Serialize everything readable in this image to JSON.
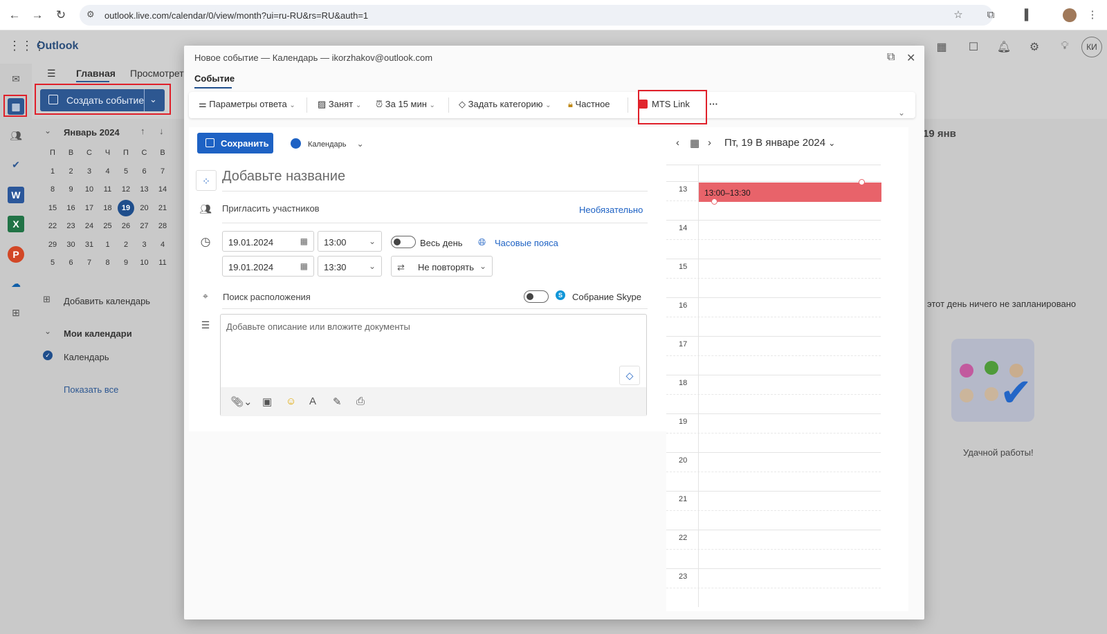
{
  "browser": {
    "url": "outlook.live.com/calendar/0/view/month?ui=ru-RU&rs=RU&auth=1"
  },
  "outlook": {
    "brand": "Outlook",
    "ribbon_tabs": [
      "Главная",
      "Просмотреть"
    ],
    "create_event_label": "Создать событие",
    "user_initials": "КИ",
    "mini_calendar": {
      "title": "Январь 2024",
      "weekdays": [
        "П",
        "В",
        "С",
        "Ч",
        "П",
        "С",
        "В"
      ],
      "weeks": [
        [
          "1",
          "2",
          "3",
          "4",
          "5",
          "6",
          "7"
        ],
        [
          "8",
          "9",
          "10",
          "11",
          "12",
          "13",
          "14"
        ],
        [
          "15",
          "16",
          "17",
          "18",
          "19",
          "20",
          "21"
        ],
        [
          "22",
          "23",
          "24",
          "25",
          "26",
          "27",
          "28"
        ],
        [
          "29",
          "30",
          "31",
          "1",
          "2",
          "3",
          "4"
        ],
        [
          "5",
          "6",
          "7",
          "8",
          "9",
          "10",
          "11"
        ]
      ],
      "today": "19"
    },
    "add_calendar": "Добавить календарь",
    "my_calendars": "Мои календари",
    "calendar_name": "Календарь",
    "show_all": "Показать все",
    "right_panel": {
      "title": "19 янв",
      "empty_text": "этот день ничего не запланировано",
      "good_work": "Удачной работы!"
    }
  },
  "modal": {
    "title": "Новое событие — Календарь — ikorzhakov@outlook.com",
    "tab": "Событие",
    "toolbar": {
      "response_options": "Параметры ответа",
      "busy": "Занят",
      "reminder": "За 15 мин",
      "category": "Задать категорию",
      "private": "Частное",
      "mts_link": "MTS Link",
      "more": "···"
    },
    "save": "Сохранить",
    "calendar_select": "Календарь",
    "title_placeholder": "Добавьте название",
    "invite_placeholder": "Пригласить участников",
    "optional": "Необязательно",
    "start_date": "19.01.2024",
    "start_time": "13:00",
    "end_date": "19.01.2024",
    "end_time": "13:30",
    "all_day": "Весь день",
    "time_zones": "Часовые пояса",
    "repeat": "Не повторять",
    "location_placeholder": "Поиск расположения",
    "skype": "Собрание Skype",
    "description_placeholder": "Добавьте описание или вложите документы",
    "day_view": {
      "title": "Пт, 19 В январе 2024",
      "hours": [
        "13",
        "14",
        "15",
        "16",
        "17",
        "18",
        "19",
        "20",
        "21",
        "22",
        "23"
      ],
      "event_time": "13:00–13:30"
    }
  },
  "colors": {
    "accent": "#1e62c4",
    "brand_dark": "#1f4e8c",
    "event": "#e8636a",
    "highlight": "#e0202a",
    "mts_red": "#e1262d"
  }
}
